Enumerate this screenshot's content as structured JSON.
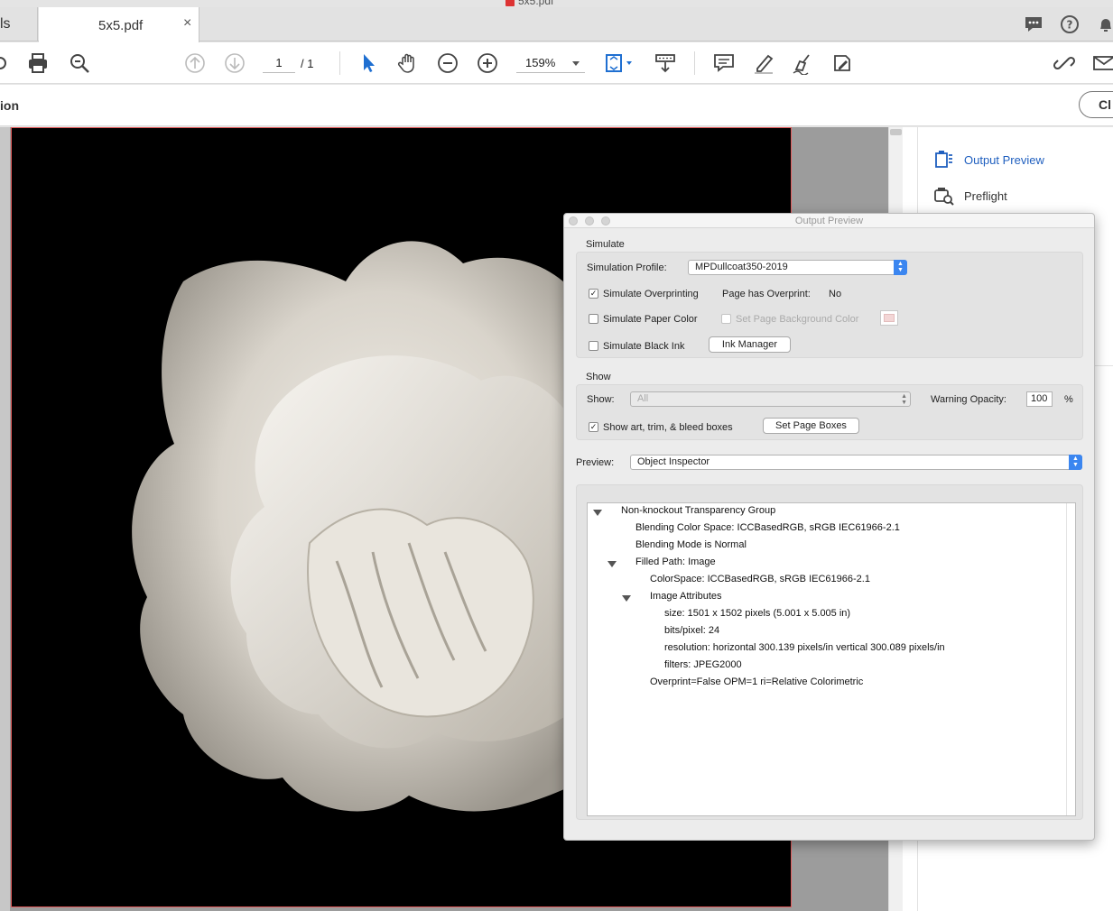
{
  "window": {
    "title": "5x5.pdf"
  },
  "tabs": {
    "tools_label": "ls",
    "document_label": "5x5.pdf",
    "close_glyph": "×"
  },
  "toolbar": {
    "page_current": "1",
    "page_total": "/ 1",
    "zoom": "159%"
  },
  "subbar": {
    "title": "ion",
    "close_label": "Cl"
  },
  "right_panel": {
    "items": [
      {
        "label": "Output Preview",
        "icon": "output-preview-icon",
        "color": "#1f5fbf"
      },
      {
        "label": "Preflight",
        "icon": "preflight-icon",
        "color": "#333333"
      }
    ]
  },
  "dialog": {
    "title": "Output Preview",
    "simulate": {
      "group_label": "Simulate",
      "profile_label": "Simulation Profile:",
      "profile_value": "MPDullcoat350-2019",
      "overprint_label": "Simulate Overprinting",
      "overprint_checked": true,
      "page_overprint_label": "Page has Overprint:",
      "page_overprint_value": "No",
      "paper_color_label": "Simulate Paper Color",
      "bg_color_label": "Set Page Background Color",
      "black_ink_label": "Simulate Black Ink",
      "ink_manager_label": "Ink Manager"
    },
    "show": {
      "group_label": "Show",
      "show_label": "Show:",
      "show_value": "All",
      "warning_label": "Warning Opacity:",
      "warning_value": "100",
      "warning_unit": "%",
      "boxes_label": "Show art, trim, & bleed boxes",
      "boxes_checked": true,
      "set_boxes_label": "Set Page Boxes"
    },
    "preview": {
      "label": "Preview:",
      "value": "Object Inspector"
    },
    "inspector": {
      "lines": [
        {
          "text": "Non-knockout Transparency Group",
          "expanded": true
        },
        {
          "text": "Blending Color Space: ICCBasedRGB, sRGB IEC61966-2.1"
        },
        {
          "text": "Blending Mode is Normal"
        },
        {
          "text": "Filled Path: Image",
          "expanded": true
        },
        {
          "text": "ColorSpace: ICCBasedRGB, sRGB IEC61966-2.1"
        },
        {
          "text": "Image Attributes",
          "expanded": true
        },
        {
          "text": "size: 1501 x 1502 pixels (5.001 x 5.005 in)"
        },
        {
          "text": "bits/pixel: 24"
        },
        {
          "text": "resolution: horizontal 300.139 pixels/in vertical 300.089 pixels/in"
        },
        {
          "text": "filters: JPEG2000"
        },
        {
          "text": "Overprint=False OPM=1 ri=Relative Colorimetric"
        }
      ]
    }
  },
  "colors": {
    "accent": "#3b86f0",
    "page_border": "#e05a5a",
    "canvas_bg": "#9c9c9c"
  }
}
